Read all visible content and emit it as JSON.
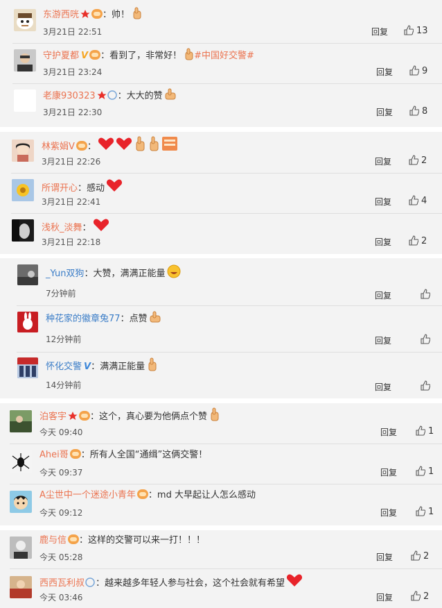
{
  "actions": {
    "reply_label": "回复"
  },
  "comments": [
    {
      "user": "东游西咣",
      "text": "帅！",
      "time": "3月21日 22:51",
      "likes": "13"
    },
    {
      "user": "守护夏都",
      "text": "看到了，非常好！",
      "tag": "#中国好交警#",
      "time": "3月21日 23:24",
      "likes": "9"
    },
    {
      "user": "老康930323",
      "text": "大大的赞",
      "time": "3月21日 22:30",
      "likes": "8"
    },
    {
      "user": "林紫娟V",
      "text": "",
      "time": "3月21日 22:26",
      "likes": "2"
    },
    {
      "user": "所谓开心",
      "text": "感动",
      "time": "3月21日 22:41",
      "likes": "4"
    },
    {
      "user": "浅秋_淡舞",
      "text": "",
      "time": "3月21日 22:18",
      "likes": "2"
    },
    {
      "user": "_Yun双狗",
      "text": "大赞，满满正能量",
      "time": "7分钟前"
    },
    {
      "user": "种花家的徽章兔77",
      "text": "点赞",
      "time": "12分钟前"
    },
    {
      "user": "怀化交警",
      "text": "满满正能量",
      "time": "14分钟前"
    },
    {
      "user": "泊客宇",
      "text": "这个，真心要为他俩点个赞",
      "time": "今天 09:40",
      "likes": "1"
    },
    {
      "user": "Ahei哥",
      "text": "所有人全国“通缉”这俩交警！",
      "time": "今天 09:37",
      "likes": "1"
    },
    {
      "user": "A尘世中一个迷途小青年",
      "text": "md 大早起让人怎么感动",
      "time": "今天 09:12",
      "likes": "1"
    },
    {
      "user": "鹿与信",
      "text": "这样的交警可以来一打！！！",
      "time": "今天 05:28",
      "likes": "2"
    },
    {
      "user": "西西瓦利叔",
      "text": "越来越多年轻人参与社会，这个社会就有希望",
      "time": "今天 03:46",
      "likes": "2"
    }
  ]
}
